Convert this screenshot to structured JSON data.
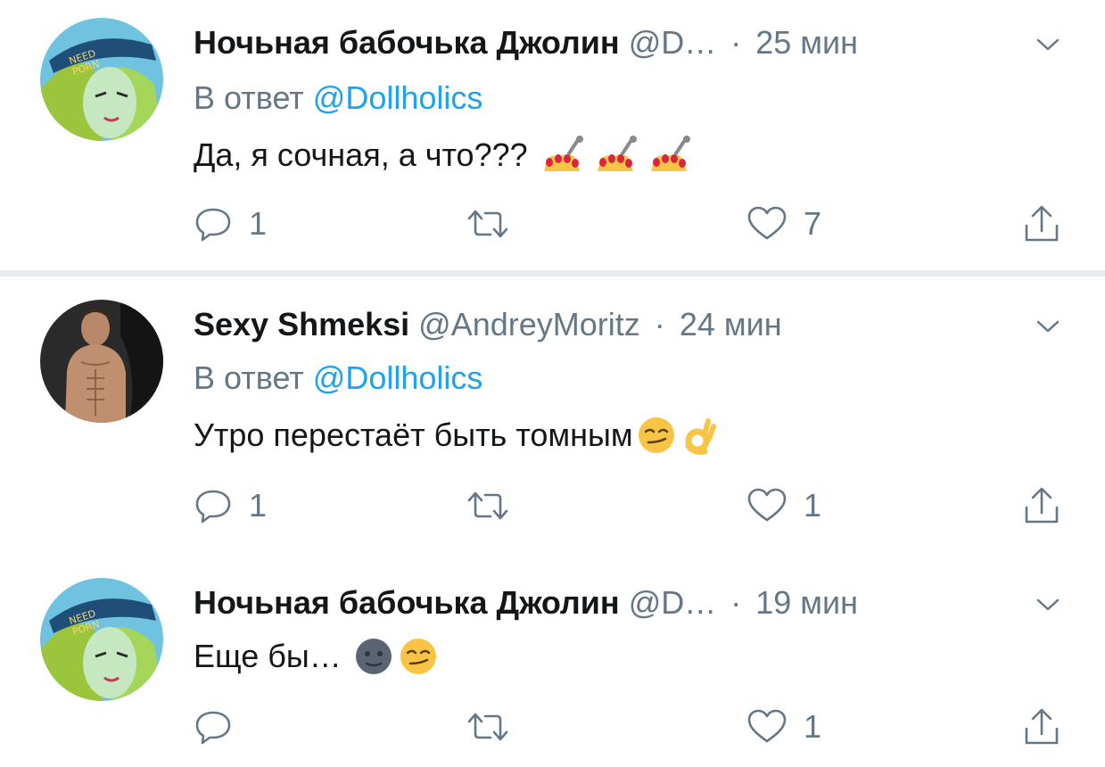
{
  "tweets": [
    {
      "name": "Ночьная бабочька Джолин",
      "handle": "@D…",
      "dot": "·",
      "time": "25 мин",
      "reply_prefix": "В ответ",
      "reply_mention": "@Dollholics",
      "text": "Да, я сочная, а что???",
      "emojis": [
        "nail-polish",
        "nail-polish",
        "nail-polish"
      ],
      "counts": {
        "reply": "1",
        "retweet": "",
        "like": "7"
      }
    },
    {
      "name": "Sexy Shmeksi",
      "handle": "@AndreyMoritz",
      "dot": "·",
      "time": "24 мин",
      "reply_prefix": "В ответ",
      "reply_mention": "@Dollholics",
      "text": "Утро перестаёт быть томным",
      "emojis": [
        "smirking-face",
        "ok-hand"
      ],
      "counts": {
        "reply": "1",
        "retweet": "",
        "like": "1"
      }
    },
    {
      "name": "Ночьная бабочька Джолин",
      "handle": "@D…",
      "dot": "·",
      "time": "19 мин",
      "text": "Еще бы…",
      "emojis": [
        "new-moon-face",
        "smirking-face"
      ],
      "counts": {
        "reply": "",
        "retweet": "",
        "like": "1"
      }
    }
  ],
  "colors": {
    "accent": "#1da1f2",
    "secondary_text": "#657786",
    "primary_text": "#14171a",
    "divider": "#e6ecf0",
    "thread_line": "#ccd6dd"
  },
  "icons": {
    "reply": "speech-bubble-icon",
    "retweet": "retweet-arrows-icon",
    "like": "heart-outline-icon",
    "share": "share-upload-icon",
    "menu": "chevron-down-icon"
  }
}
